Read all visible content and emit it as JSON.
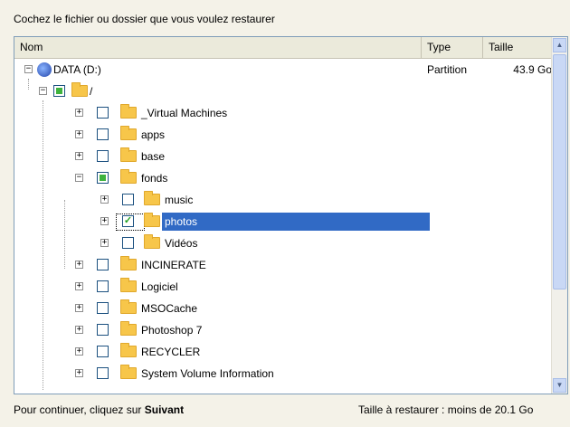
{
  "heading": "Cochez le fichier ou dossier que vous voulez restaurer",
  "columns": {
    "name": "Nom",
    "type": "Type",
    "size": "Taille"
  },
  "tree": {
    "drive": {
      "label": "DATA (D:)",
      "type": "Partition",
      "size": "43.9 Go"
    },
    "root": {
      "label": "/"
    },
    "items": [
      {
        "label": "_Virtual Machines"
      },
      {
        "label": "apps"
      },
      {
        "label": "base"
      },
      {
        "label": "fonds"
      },
      {
        "label": "music"
      },
      {
        "label": "photos"
      },
      {
        "label": "Vidéos"
      },
      {
        "label": "INCINERATE"
      },
      {
        "label": "Logiciel"
      },
      {
        "label": "MSOCache"
      },
      {
        "label": "Photoshop 7"
      },
      {
        "label": "RECYCLER"
      },
      {
        "label": "System Volume Information"
      }
    ]
  },
  "footer": {
    "hint_prefix": "Pour continuer, cliquez sur ",
    "hint_bold": "Suivant",
    "size_info": "Taille à restaurer : moins de 20.1 Go"
  },
  "colors": {
    "selection": "#316ac5",
    "folder": "#f7c64a",
    "partial_check": "#3eb33e"
  }
}
